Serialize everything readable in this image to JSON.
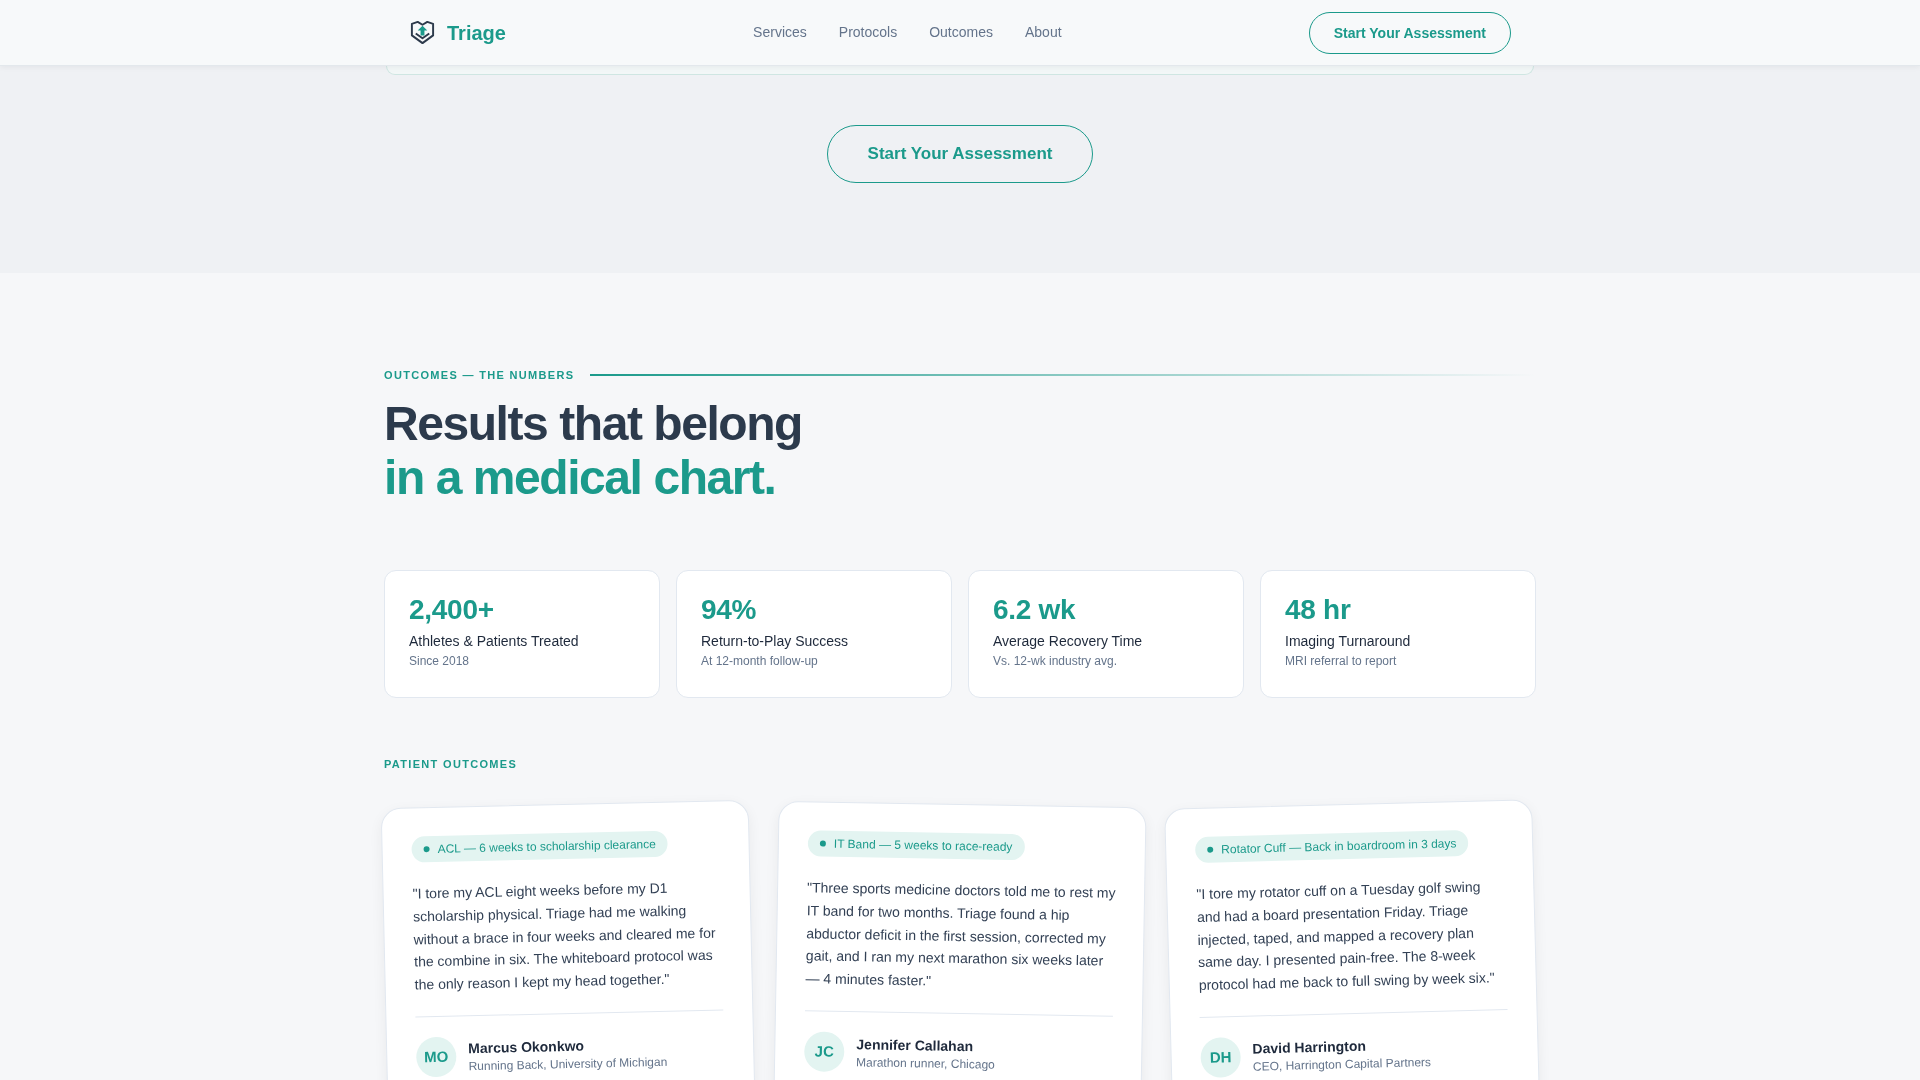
{
  "nav": {
    "brand": "Triage",
    "links": [
      "Services",
      "Protocols",
      "Outcomes",
      "About"
    ],
    "cta": "Start Your Assessment"
  },
  "hero": {
    "cta": "Start Your Assessment"
  },
  "outcomes": {
    "eyebrow": "OUTCOMES — THE NUMBERS",
    "heading": [
      {
        "text": "Results that belong",
        "kind": "plain"
      },
      {
        "text": "in a medical chart.",
        "kind": "accent"
      }
    ],
    "stats": [
      {
        "value": "2,400+",
        "label": "Athletes & Patients Treated",
        "note": "Since 2018"
      },
      {
        "value": "94%",
        "label": "Return-to-Play Success",
        "note": "At 12-month follow-up"
      },
      {
        "value": "6.2 wk",
        "label": "Average Recovery Time",
        "note": "Vs. 12-wk industry avg."
      },
      {
        "value": "48 hr",
        "label": "Imaging Turnaround",
        "note": "MRI referral to report"
      }
    ],
    "testimonials_label": "PATIENT OUTCOMES",
    "testimonials": [
      {
        "tag": "ACL — 6 weeks to scholarship clearance",
        "quote": "\"I tore my ACL eight weeks before my D1 scholarship physical. Triage had me walking without a brace in four weeks and cleared me for the combine in six. The whiteboard protocol was the only reason I kept my head together.\"",
        "initials": "MO",
        "name": "Marcus Okonkwo",
        "role": "Running Back, University of Michigan"
      },
      {
        "tag": "IT Band — 5 weeks to race-ready",
        "quote": "\"Three sports medicine doctors told me to rest my IT band for two months. Triage found a hip abductor deficit in the first session, corrected my gait, and I ran my next marathon six weeks later — 4 minutes faster.\"",
        "initials": "JC",
        "name": "Jennifer Callahan",
        "role": "Marathon runner, Chicago"
      },
      {
        "tag": "Rotator Cuff — Back in boardroom in 3 days",
        "quote": "\"I tore my rotator cuff on a Tuesday golf swing and had a board presentation Friday. Triage injected, taped, and mapped a recovery plan same day. I presented pain-free. The 8-week protocol had me back to full swing by week six.\"",
        "initials": "DH",
        "name": "David Harrington",
        "role": "CEO, Harrington Capital Partners"
      }
    ]
  }
}
